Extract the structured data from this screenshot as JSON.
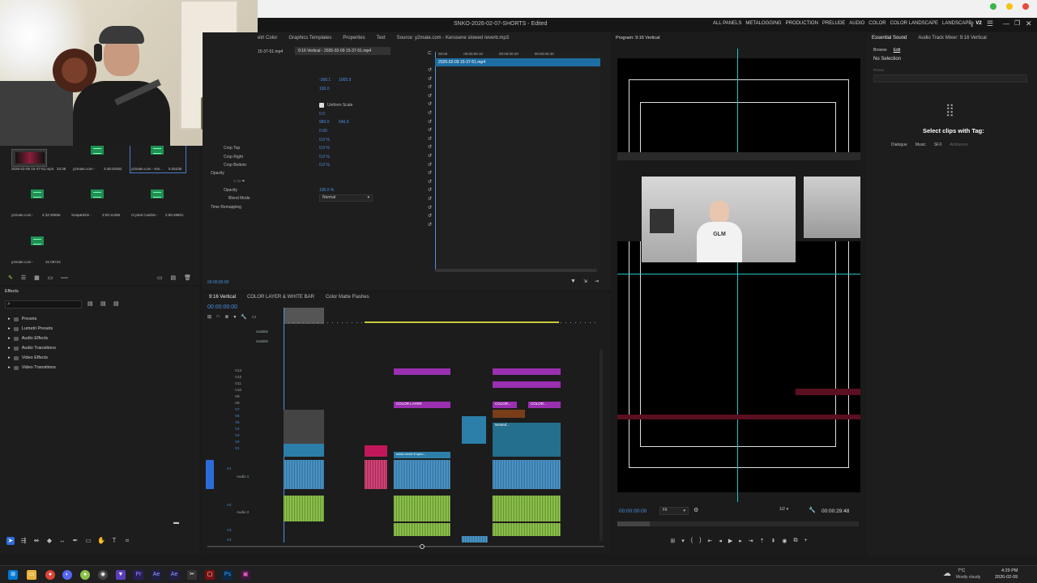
{
  "window": {
    "title": "SNKO-2026-02-07-SHORTS - Edited",
    "workspaces": [
      "ALL PANELS",
      "METALOGGING",
      "PRODUCTION",
      "PRELUDE",
      "AUDIO",
      "COLOR",
      "COLOR LANDSCAPE",
      "LANDSCAPE",
      "V2"
    ]
  },
  "effect_controls": {
    "tabs": [
      "etri Color",
      "Graphics Templates",
      "Properties",
      "Text"
    ],
    "source": "Source: y2mate.com - Kerosene slowed reverb.mp3",
    "clip_tabs": [
      "15-37-51.mp4",
      "9:16 Vertical - 2026-02-09 15-37-51.mp4"
    ],
    "clip_name": "2026-02-09 15-37-51.mp4",
    "position": [
      "-368.1",
      "1065.9"
    ],
    "scale": "100.0",
    "uniform_scale": "Uniform Scale",
    "rotation": "0.0",
    "anchor": [
      "960.0",
      "540.0"
    ],
    "flicker": "0.00",
    "crop_values": [
      "0.0 %",
      "0.0 %",
      "0.0 %",
      "0.0 %"
    ],
    "crop_labels": [
      "Crop Top",
      "Crop Right",
      "Crop Bottom"
    ],
    "opacity_label": "Opacity",
    "opacity_sub": "Opacity",
    "opacity_value": "100.0 %",
    "blend_label": "Blend Mode",
    "blend_value": "Normal",
    "time_remap": "Time Remapping",
    "timecode": "00:00:00:00",
    "ruler": [
      "00:00",
      "00:00:00:10",
      "00:00:00:20",
      "00:00:00:30"
    ]
  },
  "project": {
    "clips": [
      {
        "label": "2026-02-09 15-37-51.mp4",
        "dur": "23:38"
      },
      {
        "label": "y2mate.com -",
        "dur": "3:48:02052"
      },
      {
        "label": "y2mate.com - Ker...",
        "dur": "5:25235"
      },
      {
        "label": "y2mate.com -",
        "dur": "4:32:30656"
      },
      {
        "label": "Soap&Skin -",
        "dur": "3:05:11386"
      },
      {
        "label": "Crystal Castles -",
        "dur": "2:55:28801"
      },
      {
        "label": "y2mate.com -",
        "dur": "31:08724"
      }
    ]
  },
  "effects": {
    "title": "Effects",
    "items": [
      "Presets",
      "Lumetri Presets",
      "Audio Effects",
      "Audio Transitions",
      "Video Effects",
      "Video Transitions"
    ]
  },
  "timeline": {
    "tabs": [
      "9:16 Vertical",
      "COLOR LAYER & WHITE BAR",
      "Color Matte Flashes"
    ],
    "timecode": "00:00:00:00",
    "tracks": [
      "Subtitle",
      "Subtitle",
      "V13",
      "V12",
      "V11",
      "V10",
      "V9",
      "V8",
      "V7",
      "V6",
      "V5",
      "V4",
      "V3",
      "V2",
      "V1",
      "A1",
      "A2",
      "A3",
      "A4"
    ],
    "audio_names": [
      "Audio 1",
      "Audio 2"
    ],
    "clip_labels": [
      "COLOR LAYER",
      "COLOR...",
      "COLOR...",
      "Nested...",
      "snkko short 6 spec..."
    ]
  },
  "program": {
    "title": "Program: 9:16 Vertical",
    "timecode": "00:00:00:00",
    "fit": "Fit",
    "ratio": "1/2",
    "duration": "00:00:29:48",
    "video_caption": "GLM"
  },
  "essential_sound": {
    "tabs": [
      "Essential Sound",
      "Audio Track Mixer: 9:16 Vertical"
    ],
    "sub_tabs": [
      "Browse",
      "Edit"
    ],
    "status": "No Selection",
    "preset": "Preset",
    "prompt": "Select clips with Tag:",
    "tags": [
      "Dialogue",
      "Music",
      "SFX",
      "Ambience"
    ]
  },
  "taskbar": {
    "weather": "7°C",
    "weather_desc": "Mostly cloudy",
    "time": "4:29 PM",
    "date": "2026-02-09"
  }
}
